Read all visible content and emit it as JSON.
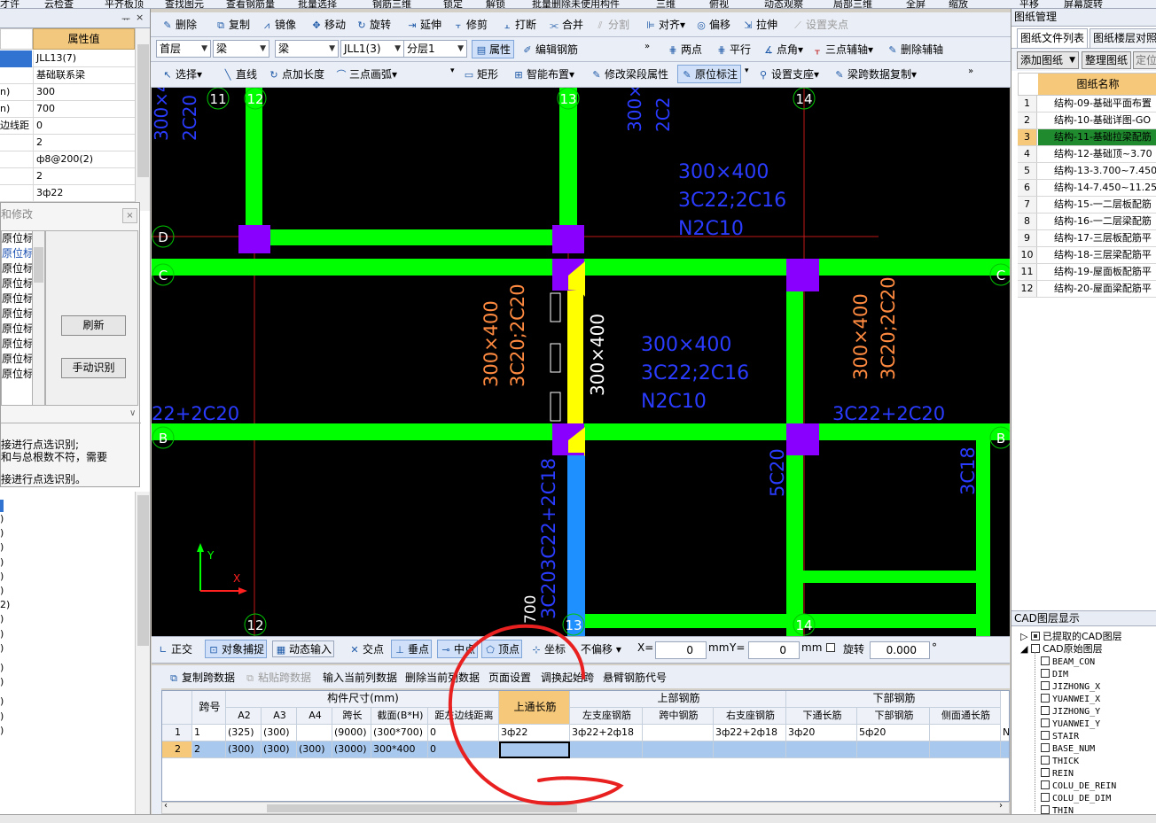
{
  "top_strip": [
    "才许",
    "云检查",
    "平齐板顶",
    "查找图元",
    "查看钢筋量",
    "批量选择",
    "钢筋三维",
    "锁定",
    "解锁",
    "批量删除未使用构件",
    "三维",
    "俯视",
    "动态观察",
    "局部三维",
    "全屏",
    "缩放",
    "平移",
    "屏幕旋转"
  ],
  "left_panel": {
    "pin_icons": [
      "ᅲ",
      "×"
    ],
    "value_header": "属性值",
    "rows": [
      {
        "key": "",
        "value": "JLL13(7)",
        "selected": true
      },
      {
        "key": "",
        "value": "基础联系梁"
      },
      {
        "key": "n)",
        "value": "300"
      },
      {
        "key": "n)",
        "value": "700"
      },
      {
        "key": "边线距",
        "value": "0"
      },
      {
        "key": "",
        "value": "2"
      },
      {
        "key": "",
        "value": "ф8@200(2)"
      },
      {
        "key": "",
        "value": "2"
      },
      {
        "key": "",
        "value": "3ф22"
      }
    ],
    "tree_marks": [
      ")",
      ")",
      ")",
      ")",
      ")",
      ")",
      "2)",
      ")",
      ")",
      ")",
      ")",
      ")",
      ")",
      ")",
      ")"
    ]
  },
  "dialog": {
    "title": "和修改",
    "close": "×",
    "list_items": [
      "原位标",
      "原位标",
      "原位标",
      "原位标",
      "原位标",
      "原位标",
      "原位标",
      "原位标",
      "原位标",
      "原位标"
    ],
    "refresh_button": "刷新",
    "manual_button": "手动识别",
    "messages": [
      "接进行点选识别;",
      "和与总根数不符，需要",
      "接进行点选识别。"
    ]
  },
  "toolbar1": {
    "delete": "删除",
    "copy": "复制",
    "mirror": "镜像",
    "move": "移动",
    "rotate": "旋转",
    "extend": "延伸",
    "trim": "修剪",
    "break": "打断",
    "merge": "合并",
    "split": "分割",
    "align": "对齐",
    "offset": "偏移",
    "stretch": "拉伸",
    "set_grip": "设置夹点"
  },
  "toolbar2": {
    "floor": "首层",
    "type1": "梁",
    "type2": "梁",
    "element": "JLL1(3)",
    "layer": "分层1",
    "attr": "属性",
    "edit_rebar": "编辑钢筋",
    "two_point": "两点",
    "parallel": "平行",
    "point_angle": "点角",
    "three_point_aux": "三点辅轴",
    "del_aux": "删除辅轴"
  },
  "toolbar3": {
    "select": "选择",
    "line": "直线",
    "point_len": "点加长度",
    "arc": "三点画弧",
    "rect": "矩形",
    "smart": "智能布置",
    "modify_span": "修改梁段属性",
    "orig_mark": "原位标注",
    "support": "设置支座",
    "span_copy": "梁跨数据复制"
  },
  "canvas": {
    "axis_top": [
      "11",
      "12",
      "13",
      "14"
    ],
    "axis_bottom": [
      "12",
      "13",
      "14"
    ],
    "axis_side": [
      "D",
      "C",
      "B"
    ],
    "annotations": {
      "tl1": "300×4",
      "tl2": "2C20",
      "mt1": "300×",
      "mt2": "2C2",
      "a1": "300×400",
      "a2": "3C22;2C16",
      "a3": "N2C10",
      "b1": "300×400",
      "b2": "3C22;2C16",
      "b3": "N2C10",
      "v_or1": "300×400",
      "v_or2": "3C20;2C20",
      "v_white": "300×400",
      "v_or3": "300×400",
      "v_or4": "3C20;2C20",
      "left_mid": "22+2C20",
      "right_mid": "3C22+2C20",
      "v_low1": "3C22+2C18",
      "v_low2": "3C20",
      "v_low3": "5C20",
      "v_low4": "3C18",
      "bottom_white": "700"
    },
    "ucs_x": "X",
    "ucs_y": "Y"
  },
  "snapbar": {
    "ortho": "正交",
    "obj_snap": "对象捕捉",
    "dyn_input": "动态输入",
    "intersection": "交点",
    "perp": "垂点",
    "mid": "中点",
    "vertex": "顶点",
    "coord": "坐标",
    "offset_mode": "不偏移",
    "x_label": "X=",
    "x_val": "0",
    "unit1": "mm",
    "y_label": "Y=",
    "y_val": "0",
    "unit2": "mm",
    "rotate_label": "旋转",
    "rotate_val": "0.000",
    "degree": "°"
  },
  "gridbar": {
    "copy_span": "复制跨数据",
    "paste_span": "粘贴跨数据",
    "input_col": "输入当前列数据",
    "del_col": "删除当前列数据",
    "page_setup": "页面设置",
    "swap_start": "调换起始跨",
    "cantilever": "悬臂钢筋代号"
  },
  "grid": {
    "headers_top": {
      "span_no": "跨号",
      "dim": "构件尺寸(mm)",
      "top_cont": "上通长筋",
      "top_rebar": "上部钢筋",
      "bot_rebar": "下部钢筋"
    },
    "headers_sub": [
      "A2",
      "A3",
      "A4",
      "跨长",
      "截面(B*H)",
      "距左边线距离",
      "左支座钢筋",
      "跨中钢筋",
      "右支座钢筋",
      "下通长筋",
      "下部钢筋",
      "侧面通长筋"
    ],
    "rows": [
      {
        "idx": "1",
        "span": "1",
        "a2": "(325)",
        "a3": "(300)",
        "a4": "",
        "len": "(9000)",
        "sec": "(300*700)",
        "dist": "0",
        "topc": "3ф22",
        "lsup": "3ф22+2ф18",
        "mid": "",
        "rsup": "3ф22+2ф18",
        "botc": "3ф20",
        "bot": "5ф20",
        "side": "",
        "extra": "N"
      },
      {
        "idx": "2",
        "span": "2",
        "a2": "(300)",
        "a3": "(300)",
        "a4": "(300)",
        "len": "(3000)",
        "sec": "300*400",
        "dist": "0",
        "topc": "",
        "lsup": "",
        "mid": "",
        "rsup": "",
        "botc": "",
        "bot": "",
        "side": "",
        "extra": ""
      }
    ]
  },
  "right_panel": {
    "title": "图纸管理",
    "tabs": [
      "图纸文件列表",
      "图纸楼层对照"
    ],
    "add": "添加图纸",
    "organize": "整理图纸",
    "locate": "定位",
    "name_header": "图纸名称",
    "drawings": [
      {
        "n": "1",
        "t": "结构-09-基础平面布置"
      },
      {
        "n": "2",
        "t": "结构-10-基础详图-GO"
      },
      {
        "n": "3",
        "t": "结构-11-基础拉梁配筋",
        "selected": true
      },
      {
        "n": "4",
        "t": "结构-12-基础顶~3.70"
      },
      {
        "n": "5",
        "t": "结构-13-3.700~7.450"
      },
      {
        "n": "6",
        "t": "结构-14-7.450~11.25"
      },
      {
        "n": "7",
        "t": "结构-15-一二层板配筋"
      },
      {
        "n": "8",
        "t": "结构-16-一二层梁配筋"
      },
      {
        "n": "9",
        "t": "结构-17-三层板配筋平"
      },
      {
        "n": "10",
        "t": "结构-18-三层梁配筋平"
      },
      {
        "n": "11",
        "t": "结构-19-屋面板配筋平"
      },
      {
        "n": "12",
        "t": "结构-20-屋面梁配筋平"
      }
    ],
    "layer_title": "CAD图层显示",
    "layer_extracted": "已提取的CAD图层",
    "layer_original": "CAD原始图层",
    "layers": [
      "BEAM_CON",
      "DIM",
      "JIZHONG_X",
      "YUANWEI_X",
      "JIZHONG_Y",
      "YUANWEI_Y",
      "STAIR",
      "BASE_NUM",
      "THICK",
      "REIN",
      "COLU_DE_REIN",
      "COLU_DE_DIM",
      "THIN"
    ]
  },
  "colors": {
    "beam_green": "#00ff00",
    "selected_beam": "#ffff00",
    "column_purple": "#8a00ff",
    "annot_blue": "#2a3cff",
    "annot_orange": "#ff8a40",
    "highlight_orange": "#f5c87a",
    "red_circle": "#e82020"
  }
}
